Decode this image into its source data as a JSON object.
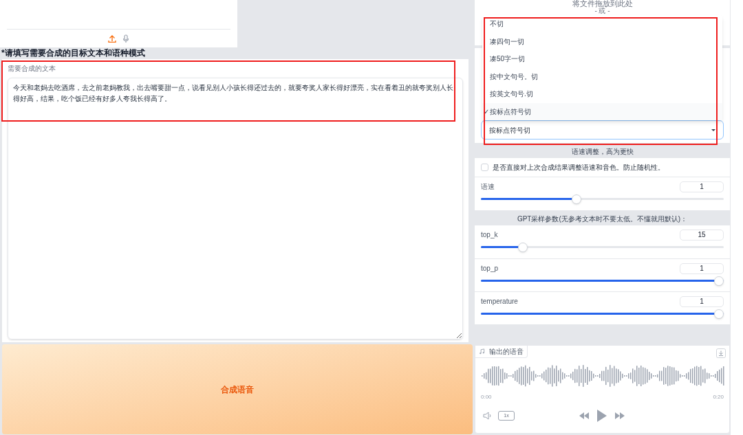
{
  "text_section": {
    "title": "*请填写需要合成的目标文本和语种模式",
    "field_label": "需要合成的文本",
    "value": "今天和老妈去吃酒席，去之前老妈教我，出去嘴要甜一点，说看见别人小孩长得还过去的，就要夸奖人家长得好漂亮，实在看着丑的就夸奖别人长得好高，结果，吃个饭已经有好多人夸我长得高了。"
  },
  "synthesize_button": "合成语音",
  "file_drop": {
    "text": "将文件拖放到此处",
    "or": "- 或 -"
  },
  "split_dropdown": {
    "value": "按标点符号切",
    "check_mark": "✓",
    "options": [
      {
        "label": "不切",
        "selected": false
      },
      {
        "label": "凑四句一切",
        "selected": false
      },
      {
        "label": "凑50字一切",
        "selected": false
      },
      {
        "label": "按中文句号。切",
        "selected": false
      },
      {
        "label": "按英文句号.切",
        "selected": false
      },
      {
        "label": "按标点符号切",
        "selected": true
      }
    ]
  },
  "speed_section": {
    "title": "语速调整，高为更快",
    "checkbox": {
      "label": "是否直接对上次合成结果调整语速和音色。防止随机性。",
      "checked": false
    },
    "slider": {
      "label": "语速",
      "value": "1",
      "level": 0.39
    }
  },
  "gpt_section": {
    "title": "GPT采样参数(无参考文本时不要太低。不懂就用默认)：",
    "sliders": [
      {
        "label": "top_k",
        "value": "15",
        "level": 0.16
      },
      {
        "label": "top_p",
        "value": "1",
        "level": 1
      },
      {
        "label": "temperature",
        "value": "1",
        "level": 1
      }
    ]
  },
  "output_audio": {
    "label": "输出的语音",
    "start": "0:00",
    "end": "0:20",
    "rate": "1x"
  }
}
